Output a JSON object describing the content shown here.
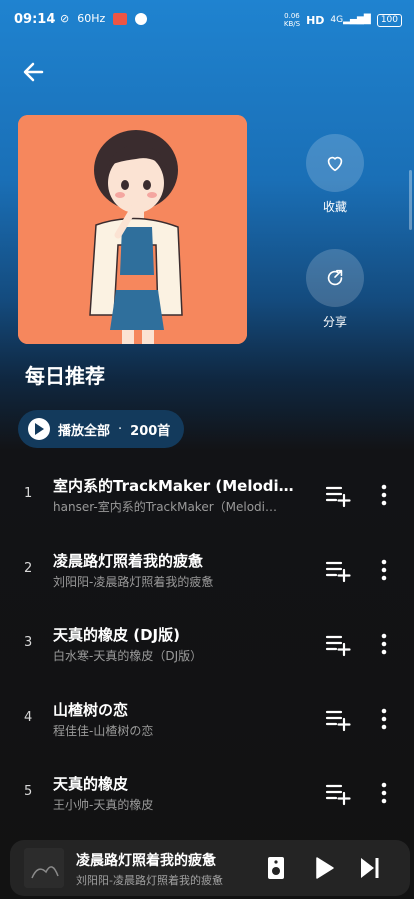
{
  "status_bar": {
    "time": "09:14",
    "network_speed_value": "0.06",
    "network_speed_unit": "KB/S",
    "hd": "HD",
    "signal": "4G",
    "battery": "100",
    "refresh_rate": "60Hz"
  },
  "playlist": {
    "title": "每日推荐",
    "favorite_label": "收藏",
    "share_label": "分享",
    "play_all_label": "播放全部",
    "separator": "·",
    "count": "200首"
  },
  "songs": [
    {
      "index": "1",
      "title": "室内系的TrackMaker (Melodi…",
      "subtitle": "hanser-室内系的TrackMaker（Melodi…"
    },
    {
      "index": "2",
      "title": "凌晨路灯照着我的疲惫",
      "subtitle": "刘阳阳-凌晨路灯照着我的疲惫"
    },
    {
      "index": "3",
      "title": "天真的橡皮 (DJ版)",
      "subtitle": "白水寒-天真的橡皮（DJ版）"
    },
    {
      "index": "4",
      "title": "山楂树の恋",
      "subtitle": "程佳佳-山楂树の恋"
    },
    {
      "index": "5",
      "title": "天真的橡皮",
      "subtitle": "王小帅-天真的橡皮"
    }
  ],
  "mini_player": {
    "title": "凌晨路灯照着我的疲惫",
    "subtitle": "刘阳阳-凌晨路灯照着我的疲惫"
  },
  "icons": {
    "back": "arrow-left-icon",
    "favorite": "heart-icon",
    "share": "share-icon",
    "play": "play-icon",
    "add_to_playlist": "playlist-add-icon",
    "more": "more-vertical-icon",
    "speaker": "speaker-icon",
    "next": "skip-next-icon"
  },
  "colors": {
    "header_blue": "#1f83d0",
    "cover_orange": "#f6875d",
    "background": "#121212",
    "play_all_bg": "#133a5c"
  }
}
